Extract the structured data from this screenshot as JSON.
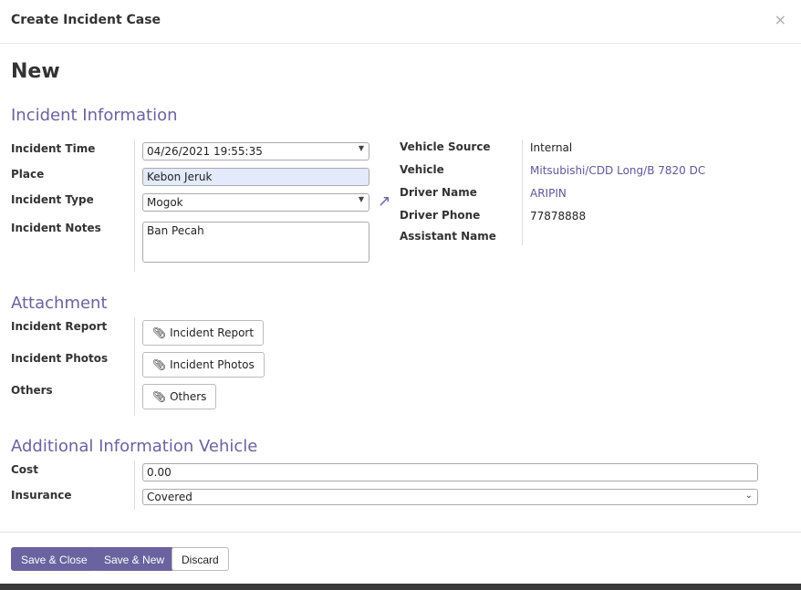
{
  "dialog": {
    "title": "Create Incident Case",
    "close": "×"
  },
  "record_title": "New",
  "sections": {
    "incident": "Incident Information",
    "attachment": "Attachment",
    "additional": "Additional Information Vehicle"
  },
  "incident": {
    "time_label": "Incident Time",
    "time_value": "04/26/2021 19:55:35",
    "place_label": "Place",
    "place_value": "Kebon Jeruk",
    "type_label": "Incident Type",
    "type_value": "Mogok",
    "notes_label": "Incident Notes",
    "notes_value": "Ban Pecah"
  },
  "vehicle": {
    "source_label": "Vehicle Source",
    "source_value": "Internal",
    "vehicle_label": "Vehicle",
    "vehicle_value": "Mitsubishi/CDD Long/B 7820 DC",
    "driver_label": "Driver Name",
    "driver_value": "ARIPIN",
    "phone_label": "Driver Phone",
    "phone_value": "77878888",
    "assistant_label": "Assistant Name"
  },
  "attachment": {
    "report_label": "Incident Report",
    "report_button": "Incident Report",
    "photos_label": "Incident Photos",
    "photos_button": "Incident Photos",
    "others_label": "Others",
    "others_button": "Others"
  },
  "additional": {
    "cost_label": "Cost",
    "cost_value": "0.00",
    "insurance_label": "Insurance",
    "insurance_value": "Covered"
  },
  "footer": {
    "save_close": "Save & Close",
    "save_new": "Save & New",
    "discard": "Discard"
  },
  "colors": {
    "accent": "#6b62a0",
    "place_bg": "#e2eafc"
  }
}
